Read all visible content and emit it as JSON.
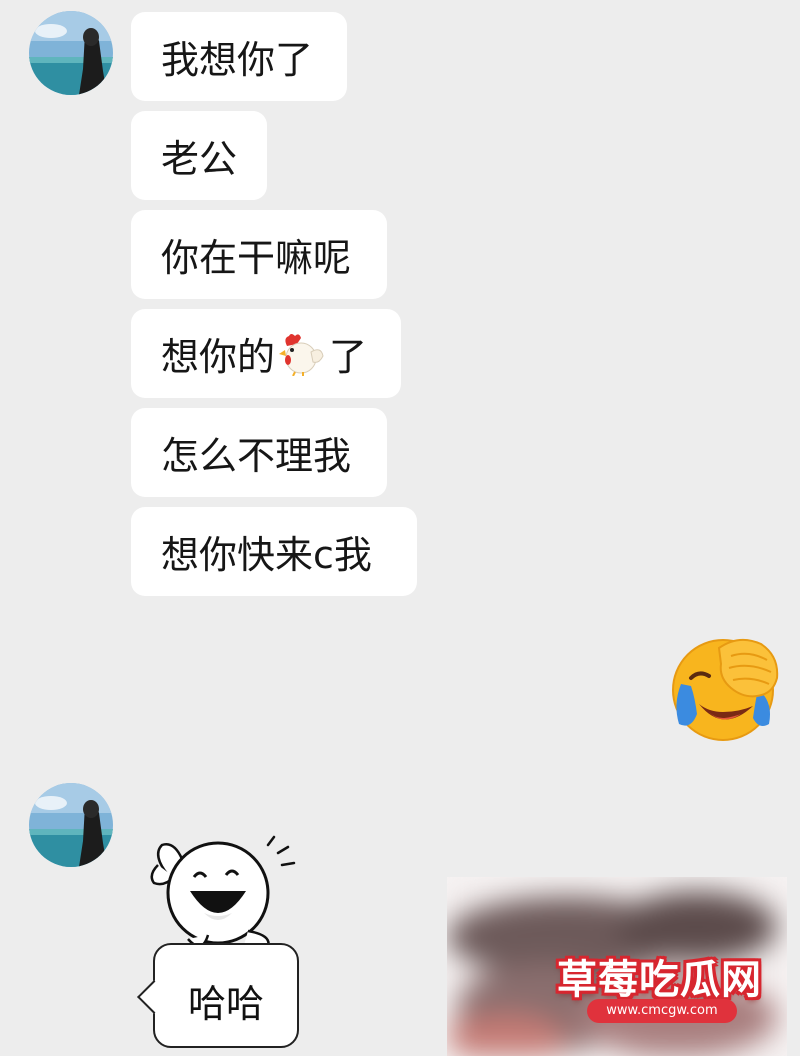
{
  "messages": [
    {
      "text": "我想你了"
    },
    {
      "text": "老公"
    },
    {
      "text": "你在干嘛呢"
    },
    {
      "text_before": "想你的",
      "emoji": "rooster-emoji",
      "text_after": "了"
    },
    {
      "text": "怎么不理我"
    },
    {
      "text": "想你快来c我"
    }
  ],
  "reply_emoji": "face-with-tears-of-joy-covering-eyes",
  "sticker": {
    "character": "laughing-round-face-character",
    "text": "哈哈"
  },
  "watermark": {
    "title": "草莓吃瓜网",
    "url": "www.cmcgw.com"
  },
  "colors": {
    "background": "#ededed",
    "bubble": "#ffffff",
    "text": "#161616",
    "watermark_red": "#d7262f"
  }
}
